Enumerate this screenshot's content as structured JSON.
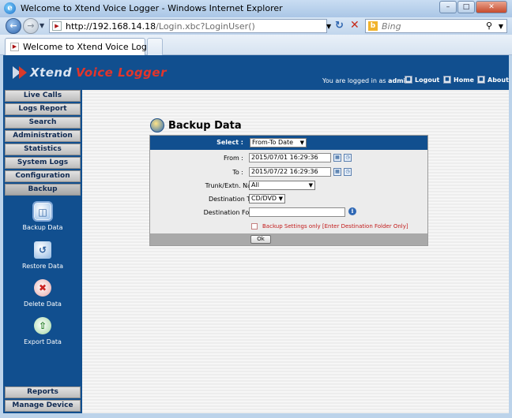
{
  "window": {
    "title": "Welcome to Xtend Voice Logger - Windows Internet Explorer",
    "min_label": "–",
    "max_label": "□",
    "close_label": "✕"
  },
  "browser": {
    "url_host": "http://192.168.14.18",
    "url_path": "/Login.xbc?LoginUser()",
    "search_placeholder": "Bing",
    "tab_label": "Welcome to Xtend Voice Logger"
  },
  "header": {
    "brand_part1": "Xtend",
    "brand_part2": "Voice Logger",
    "login_prefix": "You are logged in as",
    "user": "admin",
    "logout_label": "Logout",
    "home_label": "Home",
    "about_label": "About"
  },
  "menu": {
    "items": [
      "Live Calls",
      "Logs Report",
      "Search",
      "Administration",
      "Statistics",
      "System Logs",
      "Configuration",
      "Backup"
    ],
    "active": "Backup",
    "bottom_items": [
      "Reports",
      "Manage Device"
    ]
  },
  "backup_menu": {
    "items": [
      "Backup Data",
      "Restore Data",
      "Delete Data",
      "Export Data"
    ]
  },
  "page": {
    "title": "Backup Data"
  },
  "form": {
    "select_label": "Select :",
    "select_value": "From-To Date",
    "from_label": "From :",
    "from_value": "2015/07/01 16:29:36",
    "to_label": "To :",
    "to_value": "2015/07/22 16:29:36",
    "trunk_label": "Trunk/Extn. Name :",
    "trunk_value": "All",
    "dest_type_label": "Destination Type :",
    "dest_type_value": "CD/DVD",
    "dest_folder_label": "Destination Folder :",
    "dest_folder_value": "",
    "checkbox_label": "Backup Settings only [Enter Destination Folder Only]",
    "checkbox_checked": false,
    "ok_label": "Ok"
  },
  "colors": {
    "app_blue": "#114f8f",
    "brand_red": "#e3352b",
    "warning_red": "#c21a1a"
  }
}
